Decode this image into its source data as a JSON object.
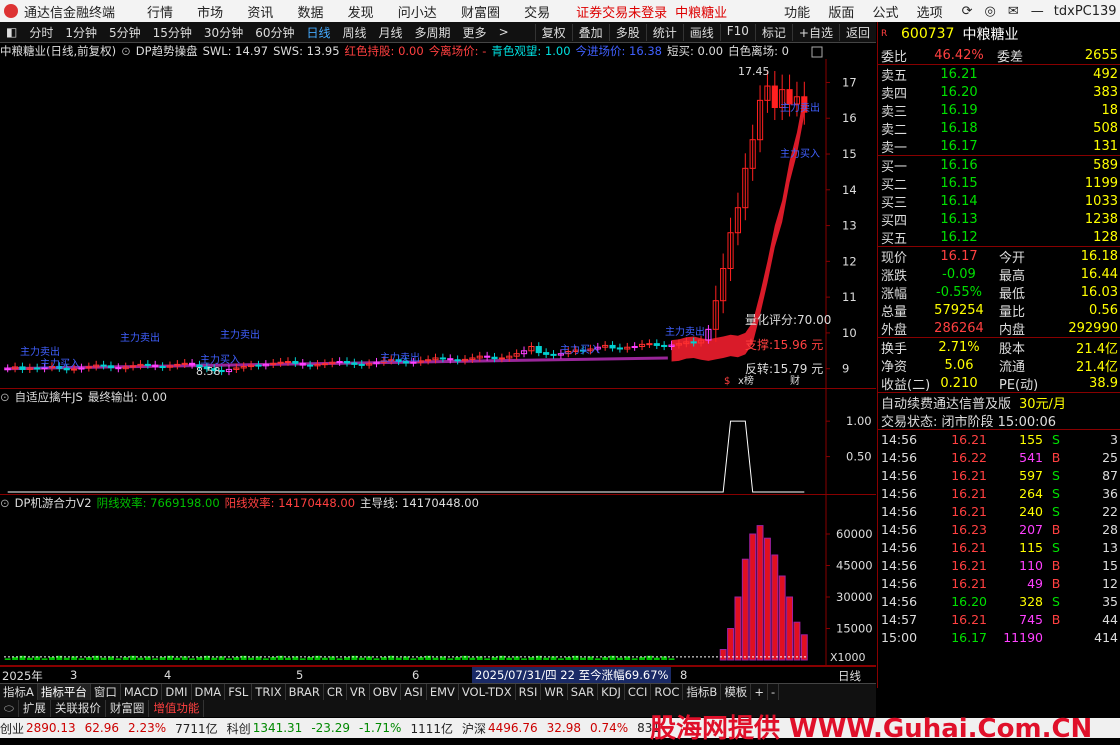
{
  "titlebar": {
    "app_title": "通达信金融终端",
    "menu": [
      "行情",
      "市场",
      "资讯",
      "数据",
      "发现",
      "问小达",
      "财富圈",
      "交易"
    ],
    "notice": "证券交易未登录",
    "stock": "中粮糖业",
    "right_menu": [
      "功能",
      "版面",
      "公式",
      "选项"
    ],
    "user": "tdxPC139"
  },
  "periods": [
    "分时",
    "1分钟",
    "5分钟",
    "15分钟",
    "30分钟",
    "60分钟",
    "日线",
    "周线",
    "月线",
    "多周期",
    "更多"
  ],
  "active_period": "日线",
  "tools": [
    "复权",
    "叠加",
    "多股",
    "统计",
    "画线",
    "F10",
    "标记",
    "+自选",
    "返回"
  ],
  "main_pane": {
    "header": [
      "中粮糖业(日线,前复权)",
      "DP趋势操盘",
      "SWL: 14.97",
      "SWS: 13.95",
      "红色持股: 0.00",
      "今离场价: -",
      "青色观望: 1.00",
      "今进场价: 16.38",
      "短买: 0.00",
      "白色离场: 0"
    ],
    "header_colors": [
      "#ddd",
      "#ddd",
      "#ddd",
      "#ddd",
      "#ff4040",
      "#ff4040",
      "#00e0e0",
      "#4060ff",
      "#ddd",
      "#ddd"
    ],
    "price_ticks": [
      17,
      16,
      15,
      14,
      13,
      12,
      11,
      10,
      9
    ],
    "ylim": [
      8.6,
      17.6
    ],
    "high_label": "17.45",
    "low_label": "8.58",
    "score_label": "量化评分:70.00",
    "support_label": "支撑:15.96 元",
    "reverse_label": "反转:15.79 元",
    "sell_text": "主力卖出",
    "buy_text": "主力买入",
    "badges": [
      "$",
      "x榜",
      "财"
    ]
  },
  "ind1": {
    "header": [
      "自适应擒牛JS",
      "最终输出: 0.00"
    ],
    "ticks": [
      1.0,
      0.5
    ],
    "ylim": [
      0,
      1.2
    ]
  },
  "ind2": {
    "header": [
      "DP机游合力V2",
      "阴线效率: 7669198.00",
      "阳线效率: 14170448.00",
      "主导线: 14170448.00"
    ],
    "header_colors": [
      "#ddd",
      "#00c000",
      "#ff4040",
      "#ddd"
    ],
    "ticks": [
      60000,
      45000,
      30000,
      15000
    ],
    "ylim": [
      0,
      70000
    ],
    "unit": "X1000"
  },
  "xaxis": {
    "labels": [
      "2025年",
      "3",
      "4",
      "5",
      "6",
      "7",
      "8"
    ],
    "range_label": "2025/07/31/四 22 至今涨幅69.67%",
    "cycle": "日线"
  },
  "quote": {
    "code": "600737",
    "name": "中粮糖业",
    "ratio_label": "委比",
    "ratio": "46.42%",
    "diff_label": "委差",
    "diff": "2655",
    "asks": [
      {
        "label": "卖五",
        "price": "16.21",
        "vol": "492"
      },
      {
        "label": "卖四",
        "price": "16.20",
        "vol": "383"
      },
      {
        "label": "卖三",
        "price": "16.19",
        "vol": "18"
      },
      {
        "label": "卖二",
        "price": "16.18",
        "vol": "508"
      },
      {
        "label": "卖一",
        "price": "16.17",
        "vol": "131"
      }
    ],
    "bids": [
      {
        "label": "买一",
        "price": "16.16",
        "vol": "589"
      },
      {
        "label": "买二",
        "price": "16.15",
        "vol": "1199"
      },
      {
        "label": "买三",
        "price": "16.14",
        "vol": "1033"
      },
      {
        "label": "买四",
        "price": "16.13",
        "vol": "1238"
      },
      {
        "label": "买五",
        "price": "16.12",
        "vol": "128"
      }
    ],
    "stats": [
      {
        "l1": "现价",
        "v1": "16.17",
        "c1": "red",
        "l2": "今开",
        "v2": "16.18",
        "c2": "red"
      },
      {
        "l1": "涨跌",
        "v1": "-0.09",
        "c1": "green",
        "l2": "最高",
        "v2": "16.44",
        "c2": "red"
      },
      {
        "l1": "涨幅",
        "v1": "-0.55%",
        "c1": "green",
        "l2": "最低",
        "v2": "16.03",
        "c2": "green"
      },
      {
        "l1": "总量",
        "v1": "579254",
        "c1": "yel",
        "l2": "量比",
        "v2": "0.56",
        "c2": "yel"
      },
      {
        "l1": "外盘",
        "v1": "286264",
        "c1": "red",
        "l2": "内盘",
        "v2": "292990",
        "c2": "green"
      }
    ],
    "stats2": [
      {
        "l1": "换手",
        "v1": "2.71%",
        "l2": "股本",
        "v2": "21.4亿"
      },
      {
        "l1": "净资",
        "v1": "5.06",
        "l2": "流通",
        "v2": "21.4亿"
      },
      {
        "l1": "收益(二)",
        "v1": "0.210",
        "l2": "PE(动)",
        "v2": "38.9"
      }
    ],
    "ad": "自动续费通达信普及版",
    "ad_price": "30元/月",
    "status": "交易状态: 闭市阶段 15:00:06",
    "ticks": [
      {
        "t": "14:56",
        "p": "16.21",
        "v": "155",
        "s": "S",
        "c": "3"
      },
      {
        "t": "14:56",
        "p": "16.22",
        "v": "541",
        "s": "B",
        "c": "25"
      },
      {
        "t": "14:56",
        "p": "16.21",
        "v": "597",
        "s": "S",
        "c": "87"
      },
      {
        "t": "14:56",
        "p": "16.21",
        "v": "264",
        "s": "S",
        "c": "36"
      },
      {
        "t": "14:56",
        "p": "16.21",
        "v": "240",
        "s": "S",
        "c": "22"
      },
      {
        "t": "14:56",
        "p": "16.23",
        "v": "207",
        "s": "B",
        "c": "28"
      },
      {
        "t": "14:56",
        "p": "16.21",
        "v": "115",
        "s": "S",
        "c": "13"
      },
      {
        "t": "14:56",
        "p": "16.21",
        "v": "110",
        "s": "B",
        "c": "15"
      },
      {
        "t": "14:56",
        "p": "16.21",
        "v": "49",
        "s": "B",
        "c": "12"
      },
      {
        "t": "14:56",
        "p": "16.20",
        "v": "328",
        "s": "S",
        "c": "35"
      },
      {
        "t": "14:57",
        "p": "16.21",
        "v": "745",
        "s": "B",
        "c": "44"
      },
      {
        "t": "15:00",
        "p": "16.17",
        "v": "11190",
        "s": "",
        "c": "414"
      }
    ]
  },
  "tabs": [
    "指标A",
    "指标平台",
    "窗口",
    "MACD",
    "DMI",
    "DMA",
    "FSL",
    "TRIX",
    "BRAR",
    "CR",
    "VR",
    "OBV",
    "ASI",
    "EMV",
    "VOL-TDX",
    "RSI",
    "WR",
    "SAR",
    "KDJ",
    "CCI",
    "ROC",
    "指标B",
    "模板",
    "+",
    "-"
  ],
  "tabs2": [
    "扩展",
    "关联报价",
    "财富圈",
    "增值功能"
  ],
  "statusbar": [
    {
      "label": "创业",
      "v": "2890.13",
      "c": "#c00"
    },
    {
      "label": "",
      "v": "62.96",
      "c": "#c00"
    },
    {
      "label": "",
      "v": "2.23%",
      "c": "#c00"
    },
    {
      "label": "",
      "v": "7711亿",
      "c": "#222"
    },
    {
      "label": "科创",
      "v": "1341.31",
      "c": "#080"
    },
    {
      "label": "",
      "v": "-23.29",
      "c": "#080"
    },
    {
      "label": "",
      "v": "-1.71%",
      "c": "#080"
    },
    {
      "label": "",
      "v": "1111亿",
      "c": "#222"
    },
    {
      "label": "沪深",
      "v": "4496.76",
      "c": "#c00"
    },
    {
      "label": "",
      "v": "32.98",
      "c": "#c00"
    },
    {
      "label": "",
      "v": "0.74%",
      "c": "#c00"
    },
    {
      "label": "",
      "v": "831",
      "c": "#222"
    }
  ],
  "watermark": "股海网提供 WWW.Guhai.Com.CN",
  "chart_data": {
    "type": "candlestick",
    "closes": [
      9.0,
      9.05,
      8.98,
      9.02,
      9.0,
      9.03,
      9.06,
      9.01,
      8.97,
      8.99,
      9.02,
      9.05,
      9.1,
      9.08,
      9.03,
      9.0,
      9.05,
      9.08,
      9.12,
      9.1,
      9.06,
      9.04,
      9.08,
      9.12,
      9.15,
      9.1,
      9.05,
      9.0,
      8.95,
      8.92,
      8.98,
      9.02,
      9.06,
      9.1,
      9.08,
      9.12,
      9.15,
      9.18,
      9.2,
      9.15,
      9.1,
      9.08,
      9.12,
      9.14,
      9.18,
      9.2,
      9.16,
      9.12,
      9.1,
      9.14,
      9.18,
      9.22,
      9.25,
      9.2,
      9.16,
      9.18,
      9.22,
      9.25,
      9.3,
      9.28,
      9.25,
      9.22,
      9.26,
      9.3,
      9.35,
      9.32,
      9.28,
      9.3,
      9.35,
      9.42,
      9.5,
      9.62,
      9.45,
      9.4,
      9.38,
      9.42,
      9.48,
      9.52,
      9.5,
      9.55,
      9.6,
      9.65,
      9.58,
      9.55,
      9.6,
      9.62,
      9.68,
      9.7,
      9.65,
      9.62,
      9.66,
      9.7,
      9.75,
      9.72,
      9.8,
      10.1,
      10.9,
      11.8,
      12.8,
      13.5,
      14.6,
      15.4,
      16.5,
      16.9,
      16.3,
      16.8,
      16.4,
      16.6,
      16.17
    ],
    "ind1_values_note": "spike 1.0 near index 100",
    "x_labels": [
      "2025年",
      "3",
      "4",
      "5",
      "6",
      "7",
      "8"
    ]
  }
}
